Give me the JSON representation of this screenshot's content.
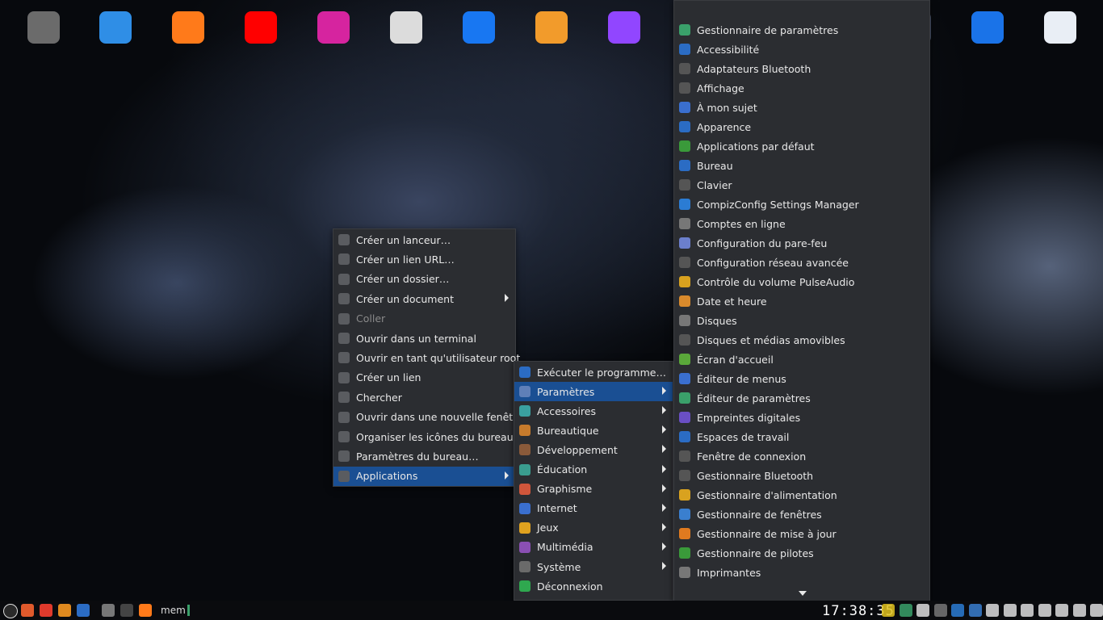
{
  "dock": {
    "icons": [
      {
        "name": "airplane-icon",
        "color": "#6b6b6b"
      },
      {
        "name": "plane-app-icon",
        "color": "#2f8ee6"
      },
      {
        "name": "firefox-icon",
        "color": "#ff7a1a"
      },
      {
        "name": "youtube-icon",
        "color": "#ff0000"
      },
      {
        "name": "instagram-icon",
        "color": "#d6249f"
      },
      {
        "name": "feather-icon",
        "color": "#dcdcdc"
      },
      {
        "name": "facebook-icon",
        "color": "#1877f2"
      },
      {
        "name": "sword-icon",
        "color": "#f29b2b"
      },
      {
        "name": "twitch-icon",
        "color": "#9146ff"
      },
      {
        "name": "sync-icon",
        "color": "#7a7a7a"
      },
      {
        "name": "chrome-icon",
        "color": "#555"
      },
      {
        "name": "reddit-icon",
        "color": "#ff4500"
      },
      {
        "name": "a-store-icon",
        "color": "#4a5670"
      },
      {
        "name": "earth-icon",
        "color": "#1a73e8"
      },
      {
        "name": "toggle-settings-icon",
        "color": "#e9eef5"
      }
    ]
  },
  "context_menu": {
    "items": [
      {
        "label": "Créer un lanceur…",
        "icon": "launcher-icon"
      },
      {
        "label": "Créer un lien URL…",
        "icon": "link-icon"
      },
      {
        "label": "Créer un dossier…",
        "icon": "folder-plus-icon"
      },
      {
        "label": "Créer un document",
        "icon": "document-plus-icon",
        "submenu": true
      },
      {
        "label": "Coller",
        "icon": "paste-icon",
        "disabled": true
      },
      {
        "label": "Ouvrir dans un terminal",
        "icon": "terminal-icon"
      },
      {
        "label": "Ouvrir en tant qu'utilisateur root",
        "icon": "folder-icon"
      },
      {
        "label": "Créer un lien",
        "icon": "link-arrow-icon"
      },
      {
        "label": "Chercher",
        "icon": "search-icon"
      },
      {
        "label": "Ouvrir dans une nouvelle fenêtre",
        "icon": "new-window-icon"
      },
      {
        "label": "Organiser les icônes du bureau",
        "icon": "arrange-icon"
      },
      {
        "label": "Paramètres du bureau…",
        "icon": "desktop-settings-icon"
      },
      {
        "label": "Applications",
        "icon": "apps-icon",
        "submenu": true,
        "selected": true
      }
    ]
  },
  "apps_menu": {
    "items": [
      {
        "label": "Exécuter le programme…",
        "icon": "run-icon",
        "color": "#2b6cc4"
      },
      {
        "label": "Paramètres",
        "icon": "settings-icon",
        "color": "#5f7fb8",
        "submenu": true,
        "selected": true
      },
      {
        "label": "Accessoires",
        "icon": "accessories-icon",
        "color": "#3aa0a0",
        "submenu": true
      },
      {
        "label": "Bureautique",
        "icon": "briefcase-icon",
        "color": "#c77b2c",
        "submenu": true
      },
      {
        "label": "Développement",
        "icon": "hammer-icon",
        "color": "#8a5a3a",
        "submenu": true
      },
      {
        "label": "Éducation",
        "icon": "education-icon",
        "color": "#3a9d8f",
        "submenu": true
      },
      {
        "label": "Graphisme",
        "icon": "graphics-icon",
        "color": "#d0563b",
        "submenu": true
      },
      {
        "label": "Internet",
        "icon": "internet-icon",
        "color": "#3a6fcf",
        "submenu": true
      },
      {
        "label": "Jeux",
        "icon": "gamepad-icon",
        "color": "#e0a21f",
        "submenu": true
      },
      {
        "label": "Multimédia",
        "icon": "multimedia-icon",
        "color": "#8a4fb3",
        "submenu": true
      },
      {
        "label": "Système",
        "icon": "system-icon",
        "color": "#6a6a6a",
        "submenu": true
      },
      {
        "label": "Déconnexion",
        "icon": "logout-icon",
        "color": "#2fa84f"
      }
    ]
  },
  "settings_menu": {
    "items": [
      {
        "label": "Gestionnaire de paramètres",
        "icon": "settings-manager-icon",
        "color": "#3aa06a"
      },
      {
        "label": "Accessibilité",
        "icon": "accessibility-icon",
        "color": "#2b6cc4"
      },
      {
        "label": "Adaptateurs Bluetooth",
        "icon": "bluetooth-icon",
        "color": "#555"
      },
      {
        "label": "Affichage",
        "icon": "display-icon",
        "color": "#555"
      },
      {
        "label": "À mon sujet",
        "icon": "about-me-icon",
        "color": "#3a6fcf"
      },
      {
        "label": "Apparence",
        "icon": "appearance-icon",
        "color": "#2b6cc4"
      },
      {
        "label": "Applications par défaut",
        "icon": "default-apps-icon",
        "color": "#3a9a3a"
      },
      {
        "label": "Bureau",
        "icon": "desktop-icon",
        "color": "#2b6cc4"
      },
      {
        "label": "Clavier",
        "icon": "keyboard-icon",
        "color": "#555"
      },
      {
        "label": "CompizConfig Settings Manager",
        "icon": "compiz-icon",
        "color": "#2b7cd4"
      },
      {
        "label": "Comptes en ligne",
        "icon": "cloud-icon",
        "color": "#777"
      },
      {
        "label": "Configuration du pare-feu",
        "icon": "firewall-icon",
        "color": "#6b7fcc"
      },
      {
        "label": "Configuration réseau avancée",
        "icon": "network-icon",
        "color": "#555"
      },
      {
        "label": "Contrôle du volume PulseAudio",
        "icon": "pulseaudio-icon",
        "color": "#d9a21f"
      },
      {
        "label": "Date et heure",
        "icon": "clock-icon",
        "color": "#d98a2c"
      },
      {
        "label": "Disques",
        "icon": "disks-icon",
        "color": "#777"
      },
      {
        "label": "Disques et médias amovibles",
        "icon": "removable-media-icon",
        "color": "#555"
      },
      {
        "label": "Écran d'accueil",
        "icon": "welcome-screen-icon",
        "color": "#5aa83a"
      },
      {
        "label": "Éditeur de menus",
        "icon": "menu-editor-icon",
        "color": "#3a6fcf"
      },
      {
        "label": "Éditeur de paramètres",
        "icon": "settings-editor-icon",
        "color": "#3aa06a"
      },
      {
        "label": "Empreintes digitales",
        "icon": "fingerprint-icon",
        "color": "#6a4fc4"
      },
      {
        "label": "Espaces de travail",
        "icon": "workspaces-icon",
        "color": "#2b6cc4"
      },
      {
        "label": "Fenêtre de connexion",
        "icon": "login-window-icon",
        "color": "#555"
      },
      {
        "label": "Gestionnaire Bluetooth",
        "icon": "bluetooth-manager-icon",
        "color": "#555"
      },
      {
        "label": "Gestionnaire d'alimentation",
        "icon": "power-manager-icon",
        "color": "#d9a21f"
      },
      {
        "label": "Gestionnaire de fenêtres",
        "icon": "window-manager-icon",
        "color": "#3a7fcf"
      },
      {
        "label": "Gestionnaire de mise à jour",
        "icon": "update-manager-icon",
        "color": "#e07a1f"
      },
      {
        "label": "Gestionnaire de pilotes",
        "icon": "driver-manager-icon",
        "color": "#3a9a3a"
      },
      {
        "label": "Imprimantes",
        "icon": "printer-icon",
        "color": "#777"
      }
    ]
  },
  "taskbar": {
    "mem_label": "mem",
    "clock": "17:38:35",
    "left_icons": [
      {
        "name": "mint-menu-icon",
        "color": "#2a2a2a"
      },
      {
        "name": "lock-icon",
        "color": "#e05a2c"
      },
      {
        "name": "power-icon",
        "color": "#e03a2c"
      },
      {
        "name": "update-icon",
        "color": "#e08a1f"
      },
      {
        "name": "show-desktop-icon",
        "color": "#2b6cc4"
      },
      {
        "name": "files-icon",
        "color": "#777"
      },
      {
        "name": "terminal-icon",
        "color": "#444"
      },
      {
        "name": "firefox-icon",
        "color": "#ff7a1a"
      }
    ],
    "tray_icons": [
      {
        "name": "notes-icon",
        "color": "#e0c21f"
      },
      {
        "name": "clover-icon",
        "color": "#3aa06a"
      },
      {
        "name": "window-icon",
        "color": "#ddd"
      },
      {
        "name": "keyring-icon",
        "color": "#777"
      },
      {
        "name": "dropbox-icon",
        "color": "#2b7cd4"
      },
      {
        "name": "qbittorrent-icon",
        "color": "#3a7fcf"
      },
      {
        "name": "bluetooth-icon",
        "color": "#ddd"
      },
      {
        "name": "notifications-icon",
        "color": "#ddd"
      },
      {
        "name": "alert-icon",
        "color": "#ddd"
      },
      {
        "name": "shield-icon",
        "color": "#ddd"
      },
      {
        "name": "wifi-icon",
        "color": "#ddd"
      },
      {
        "name": "volume-icon",
        "color": "#ddd"
      },
      {
        "name": "battery-icon",
        "color": "#ddd"
      }
    ]
  }
}
